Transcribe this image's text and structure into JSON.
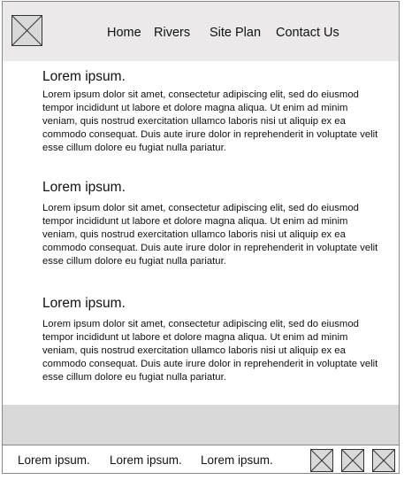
{
  "header": {
    "logo_icon": "image-placeholder-icon",
    "nav": [
      {
        "label": "Home"
      },
      {
        "label": "Rivers"
      },
      {
        "label": "Site Plan"
      },
      {
        "label": "Contact Us"
      }
    ]
  },
  "main": {
    "sections": [
      {
        "heading": "Lorem ipsum.",
        "body": "Lorem ipsum dolor sit amet, consectetur adipiscing elit, sed do eiusmod tempor incididunt ut labore et dolore magna aliqua. Ut enim ad minim veniam, quis nostrud exercitation ullamco laboris nisi ut aliquip ex ea commodo consequat. Duis aute irure dolor in reprehenderit in voluptate velit esse cillum dolore eu fugiat nulla pariatur."
      },
      {
        "heading": "Lorem ipsum.",
        "body": "Lorem ipsum dolor sit amet, consectetur adipiscing elit, sed do eiusmod tempor incididunt ut labore et dolore magna aliqua. Ut enim ad minim veniam, quis nostrud exercitation ullamco laboris nisi ut aliquip ex ea commodo consequat. Duis aute irure dolor in reprehenderit in voluptate velit esse cillum dolore eu fugiat nulla pariatur."
      },
      {
        "heading": "Lorem ipsum.",
        "body": "Lorem ipsum dolor sit amet, consectetur adipiscing elit, sed do eiusmod tempor incididunt ut labore et dolore magna aliqua. Ut enim ad minim veniam, quis nostrud exercitation ullamco laboris nisi ut aliquip ex ea commodo consequat. Duis aute irure dolor in reprehenderit in voluptate velit esse cillum dolore eu fugiat nulla pariatur."
      }
    ]
  },
  "footer": {
    "links": [
      {
        "label": "Lorem ipsum."
      },
      {
        "label": "Lorem ipsum."
      },
      {
        "label": "Lorem ipsum."
      }
    ],
    "social_icons": [
      "image-placeholder-icon",
      "image-placeholder-icon",
      "image-placeholder-icon"
    ]
  },
  "colors": {
    "header_bg": "#ebe9ea",
    "placeholder_fill": "#d9d9d9",
    "band_bg": "#d9d9d9",
    "border": "#8a8a8a",
    "text": "#111111"
  }
}
